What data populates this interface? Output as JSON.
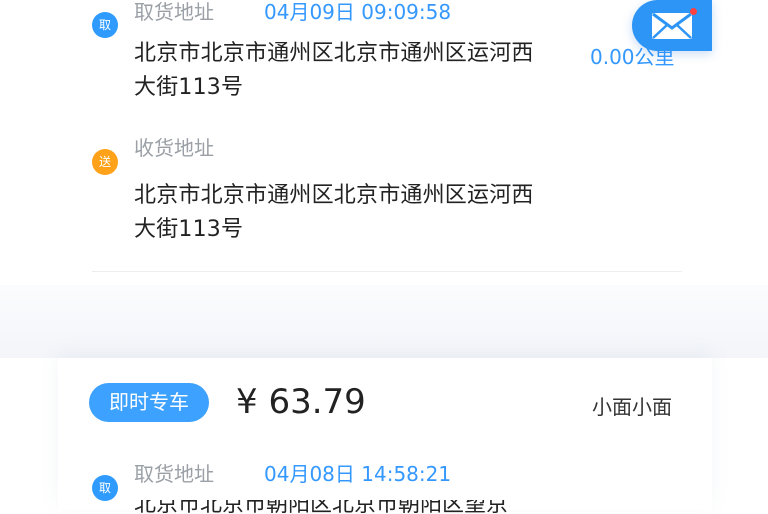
{
  "orders": [
    {
      "pickup": {
        "badge": "取",
        "label": "取货地址",
        "time": "04月09日  09:09:58",
        "address": "北京市北京市通州区北京市通州区运河西大街113号",
        "distance": "0.00公里"
      },
      "delivery": {
        "badge": "送",
        "label": "收货地址",
        "address": "北京市北京市通州区北京市通州区运河西大街113号"
      }
    },
    {
      "type_label": "即时专车",
      "price": "¥ 63.79",
      "vehicle": "小面小面",
      "pickup": {
        "badge": "取",
        "label": "取货地址",
        "time": "04月08日  14:58:21",
        "address": "北京市北京市朝阳区北京市朝阳区望京"
      }
    }
  ],
  "icons": {
    "mail": "envelope-icon",
    "accent": "#2d95f5"
  }
}
